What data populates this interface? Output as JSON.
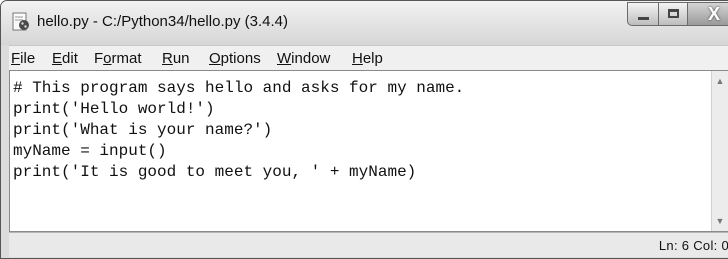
{
  "window": {
    "title": "hello.py - C:/Python34/hello.py (3.4.4)",
    "icon": "python-file-icon",
    "close_symbol": "X"
  },
  "menu": {
    "items": [
      {
        "label": "File",
        "mnemonic_index": 0
      },
      {
        "label": "Edit",
        "mnemonic_index": 0
      },
      {
        "label": "Format",
        "mnemonic_index": 1
      },
      {
        "label": "Run",
        "mnemonic_index": 0
      },
      {
        "label": "Options",
        "mnemonic_index": 0
      },
      {
        "label": "Window",
        "mnemonic_index": 0
      },
      {
        "label": "Help",
        "mnemonic_index": 0
      }
    ]
  },
  "editor": {
    "lines": [
      "# This program says hello and asks for my name.",
      "print('Hello world!')",
      "print('What is your name?')",
      "myName = input()",
      "print('It is good to meet you, ' + myName)"
    ]
  },
  "status": {
    "position": "Ln: 6  Col: 0"
  }
}
